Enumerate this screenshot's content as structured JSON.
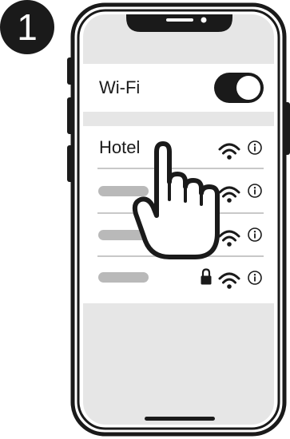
{
  "step": {
    "number": "1"
  },
  "wifi": {
    "label": "Wi-Fi",
    "enabled": true
  },
  "networks": [
    {
      "name": "Hotel",
      "locked": false,
      "signal_icon": "wifi-icon",
      "info_icon": "info-icon",
      "tapped": true
    },
    {
      "name": "",
      "locked": false,
      "signal_icon": "wifi-icon",
      "info_icon": "info-icon"
    },
    {
      "name": "",
      "locked": false,
      "signal_icon": "wifi-icon",
      "info_icon": "info-icon"
    },
    {
      "name": "",
      "locked": true,
      "signal_icon": "wifi-icon",
      "info_icon": "info-icon",
      "lock_icon": "lock-icon"
    }
  ],
  "pointer": {
    "icon": "hand-pointer-icon"
  },
  "colors": {
    "ink": "#1a1a1a",
    "screen_bg": "#e6e6e6",
    "list_bg": "#ffffff",
    "placeholder": "#b9b9b9"
  }
}
